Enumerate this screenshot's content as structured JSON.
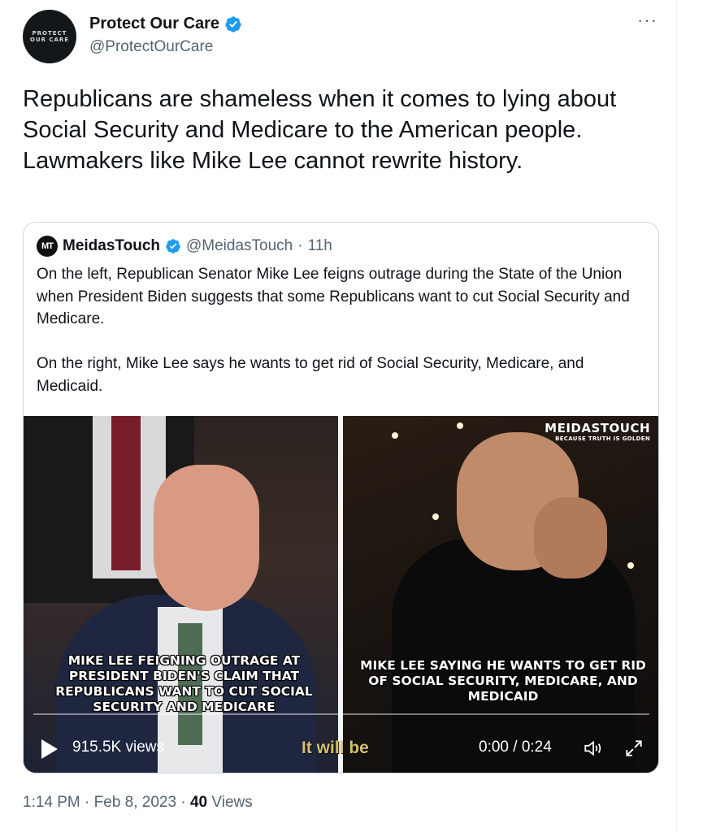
{
  "author": {
    "display_name": "Protect Our Care",
    "handle": "@ProtectOurCare",
    "avatar_line1": "PROTECT",
    "avatar_line2": "OUR CARE",
    "more_label": "···"
  },
  "tweet_text": "Republicans are shameless when it comes to lying about Social Security and Medicare to the American people. Lawmakers like Mike Lee cannot rewrite history.",
  "quoted": {
    "avatar_text": "MT",
    "display_name": "MeidasTouch",
    "handle": "@MeidasTouch",
    "separator": "·",
    "age": "11h",
    "paragraph1": "On the left, Republican Senator Mike Lee feigns outrage during the State of the Union when President Biden suggests that some Republicans want to cut Social Security and Medicare.",
    "paragraph2": "On the right, Mike Lee says he wants to get rid of Social Security, Medicare, and Medicaid.",
    "video": {
      "watermark_title": "MEIDASTOUCH",
      "watermark_sub": "BECAUSE TRUTH IS GOLDEN",
      "caption_left": "MIKE LEE FEIGNING OUTRAGE AT PRESIDENT BIDEN'S CLAIM THAT REPUBLICANS WANT TO CUT SOCIAL SECURITY AND MEDICARE",
      "caption_right": "MIKE LEE SAYING HE WANTS TO GET RID OF SOCIAL SECURITY, MEDICARE, AND MEDICAID",
      "overlay_text": "It will be",
      "views": "915.5K views",
      "time": "0:00 / 0:24",
      "progress": 0
    }
  },
  "meta": {
    "time": "1:14 PM",
    "dot": "·",
    "date": "Feb 8, 2023",
    "views_count": "40",
    "views_label": "Views"
  },
  "colors": {
    "verified_blue": "#1d9bf0",
    "secondary_text": "#536471",
    "border": "#cfd9de"
  },
  "icons": [
    "verified-badge-icon",
    "more-icon",
    "play-icon",
    "volume-icon",
    "expand-icon"
  ]
}
